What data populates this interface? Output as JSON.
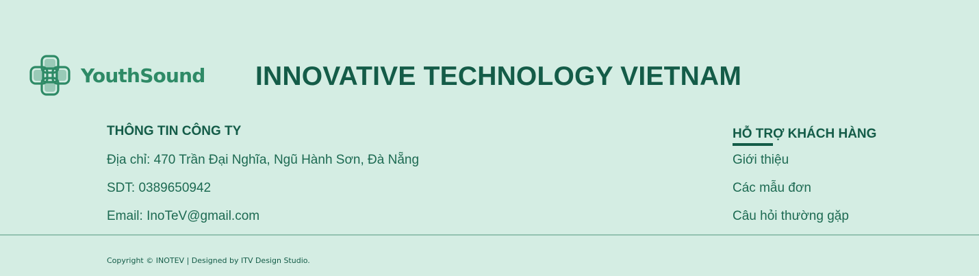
{
  "brand": {
    "logo_text": "YouthSound",
    "company_name": "INNOVATIVE TECHNOLOGY VIETNAM"
  },
  "company_info": {
    "heading": "THÔNG TIN CÔNG TY",
    "address": "Địa chỉ: 470 Trần Đại Nghĩa, Ngũ Hành Sơn, Đà Nẵng",
    "phone": "SDT: 0389650942",
    "email": "Email: InoTeV@gmail.com"
  },
  "support": {
    "heading": "HỖ TRỢ KHÁCH HÀNG",
    "links": [
      {
        "label": "Giới thiệu"
      },
      {
        "label": "Các mẫu đơn"
      },
      {
        "label": "Câu hỏi thường gặp"
      }
    ]
  },
  "copyright": "Copyright © INOTEV | Designed by ITV Design Studio.",
  "colors": {
    "background": "#d4ede3",
    "primary": "#145c48",
    "logo": "#2e8a66",
    "divider": "#93c2b0"
  }
}
